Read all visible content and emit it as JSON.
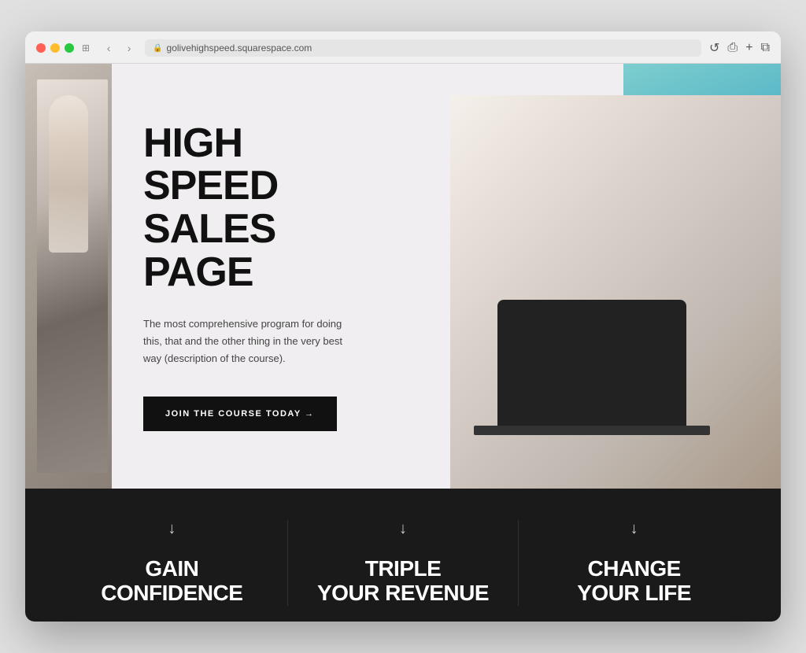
{
  "browser": {
    "url": "golivehighspeed.squarespace.com",
    "reload_label": "↺",
    "back_label": "‹",
    "forward_label": "›",
    "window_icon": "⊞",
    "share_label": "⎙",
    "new_tab_label": "+",
    "tab_label": "⧉"
  },
  "hero": {
    "title_line1": "HIGH SPEED",
    "title_line2": "SALES PAGE",
    "description": "The most comprehensive program for doing this, that and the other thing in the very best way (description of the course).",
    "cta_label": "JOIN THE COURSE TODAY →"
  },
  "features": [
    {
      "arrow": "↓",
      "title_line1": "GAIN",
      "title_line2": "CONFIDENCE"
    },
    {
      "arrow": "↓",
      "title_line1": "TRIPLE",
      "title_line2": "YOUR REVENUE"
    },
    {
      "arrow": "↓",
      "title_line1": "CHANGE",
      "title_line2": "YOUR LIFE"
    }
  ],
  "colors": {
    "hero_bg": "#f0eef0",
    "black": "#111111",
    "dark_section": "#1a1a1a"
  }
}
